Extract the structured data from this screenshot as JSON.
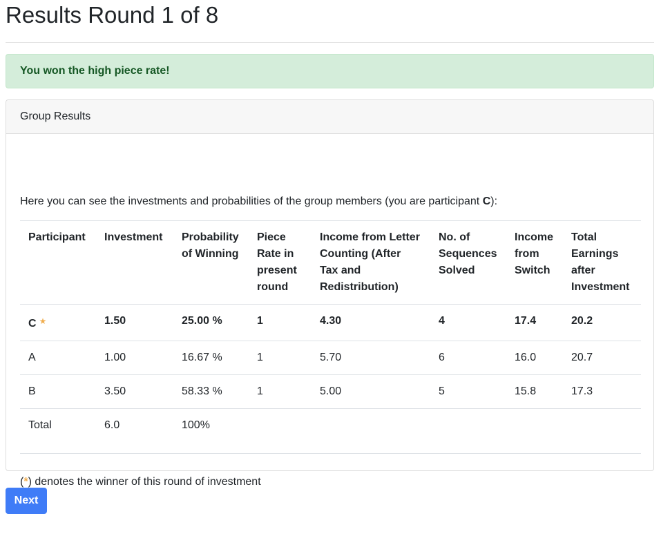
{
  "page": {
    "title": "Results Round 1 of 8"
  },
  "alert": {
    "message": "You won the high piece rate!",
    "background": "#d4edda",
    "text_color": "#155724"
  },
  "card": {
    "header": "Group Results",
    "intro_text": "Here you can see the investments and probabilities of the group members (you are participant ",
    "intro_participant": "C",
    "intro_suffix": "):"
  },
  "table": {
    "headers": [
      "Participant",
      "Investment",
      "Probability of Winning",
      "Piece Rate in present round",
      "Income from Letter Counting (After Tax and Redistribution)",
      "No. of Sequences Solved",
      "Income from Switch",
      "Total Earnings after Investment"
    ],
    "rows": [
      {
        "participant": "C",
        "winner": true,
        "investment": "1.50",
        "probability": "25.00 %",
        "piece_rate": "1",
        "income_letter": "4.30",
        "sequences": "4",
        "income_switch": "17.4",
        "total": "20.2"
      },
      {
        "participant": "A",
        "winner": false,
        "investment": "1.00",
        "probability": "16.67 %",
        "piece_rate": "1",
        "income_letter": "5.70",
        "sequences": "6",
        "income_switch": "16.0",
        "total": "20.7"
      },
      {
        "participant": "B",
        "winner": false,
        "investment": "3.50",
        "probability": "58.33 %",
        "piece_rate": "1",
        "income_letter": "5.00",
        "sequences": "5",
        "income_switch": "15.8",
        "total": "17.3"
      }
    ],
    "total_row": {
      "label": "Total",
      "investment": "6.0",
      "probability": "100%"
    }
  },
  "icons": {
    "winner_star": "star-icon",
    "star_color": "#f0ad4e"
  },
  "note": {
    "open": "(",
    "star": "*",
    "text": ") denotes the winner of this round of investment"
  },
  "buttons": {
    "next_label": "Next",
    "next_color": "#3f7cf7"
  }
}
